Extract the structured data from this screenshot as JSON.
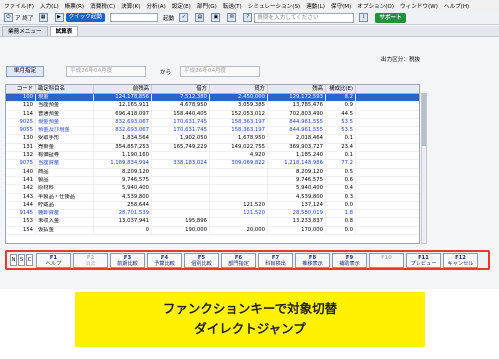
{
  "menu": [
    "ファイル(F)",
    "入力(L)",
    "帳票(R)",
    "消費税(C)",
    "決算(K)",
    "分析(A)",
    "設定(E)",
    "部門(G)",
    "転送(T)",
    "シミュレーション(S)",
    "連動(L)",
    "保守(M)",
    "オプション(O)",
    "ウィンドウ(W)",
    "ヘルプ(H)"
  ],
  "toolbar": {
    "exit": "ア 終了",
    "quick": "クイック起動",
    "start": "起動",
    "search_placeholder": "質問を入力してください",
    "support": "サポート"
  },
  "tabs": [
    "業務メニュー",
    "試算表"
  ],
  "output_kubun": "出力区分：税抜",
  "period": {
    "button": "単月指定",
    "from": "平成26年04月度",
    "to_label": "から",
    "to": "平成26年04月度"
  },
  "grid": {
    "headers": [
      "コード",
      "勘定科目名",
      "前残高",
      "借方",
      "貸方",
      "残高",
      "構成比(E)"
    ],
    "rows": [
      {
        "code": "100",
        "name": "現金",
        "prev": "124,178,856",
        "debit": "7,512,380",
        "credit": "2,450,000",
        "bal": "129,172,593",
        "ratio": "8.2",
        "type": "sel"
      },
      {
        "code": "110",
        "name": "当座預金",
        "prev": "12,165,911",
        "debit": "4,678,950",
        "credit": "3,059,385",
        "bal": "13,785,476",
        "ratio": "0.9",
        "type": ""
      },
      {
        "code": "114",
        "name": "普通預金",
        "prev": "696,418,097",
        "debit": "158,440,405",
        "credit": "152,053,012",
        "bal": "702,803,490",
        "ratio": "44.5",
        "type": ""
      },
      {
        "code": "9025",
        "name": "現金預金",
        "prev": "832,693,067",
        "debit": "170,631,745",
        "credit": "158,363,197",
        "bal": "844,961,555",
        "ratio": "53.5",
        "type": "tot"
      },
      {
        "code": "9055",
        "name": "預金及び現金",
        "prev": "832,693,067",
        "debit": "170,631,745",
        "credit": "158,363,197",
        "bal": "844,961,555",
        "ratio": "53.5",
        "type": "tot"
      },
      {
        "code": "130",
        "name": "受取手形",
        "prev": "1,834,564",
        "debit": "1,902,050",
        "credit": "1,678,950",
        "bal": "2,018,464",
        "ratio": "0.1",
        "type": ""
      },
      {
        "code": "131",
        "name": "売掛金",
        "prev": "354,857,253",
        "debit": "165,749,229",
        "credit": "149,022,755",
        "bal": "369,903,727",
        "ratio": "23.4",
        "type": ""
      },
      {
        "code": "132",
        "name": "有価証券",
        "prev": "1,190,160",
        "debit": "",
        "credit": "4,920",
        "bal": "1,185,240",
        "ratio": "0.1",
        "type": ""
      },
      {
        "code": "9075",
        "name": "当座資産",
        "prev": "1,189,834,994",
        "debit": "338,183,024",
        "credit": "309,069,822",
        "bal": "1,218,148,986",
        "ratio": "77.2",
        "type": "tot"
      },
      {
        "code": "140",
        "name": "商品",
        "prev": "8,209,120",
        "debit": "",
        "credit": "",
        "bal": "8,209,120",
        "ratio": "0.5",
        "type": ""
      },
      {
        "code": "141",
        "name": "製品",
        "prev": "9,746,575",
        "debit": "",
        "credit": "",
        "bal": "9,746,575",
        "ratio": "0.6",
        "type": ""
      },
      {
        "code": "142",
        "name": "原材料",
        "prev": "5,940,400",
        "debit": "",
        "credit": "",
        "bal": "5,940,400",
        "ratio": "0.4",
        "type": ""
      },
      {
        "code": "143",
        "name": "半製品・仕掛品",
        "prev": "4,539,800",
        "debit": "",
        "credit": "",
        "bal": "4,539,800",
        "ratio": "0.3",
        "type": ""
      },
      {
        "code": "144",
        "name": "貯蔵品",
        "prev": "258,644",
        "debit": "",
        "credit": "121,520",
        "bal": "137,124",
        "ratio": "0.0",
        "type": ""
      },
      {
        "code": "9145",
        "name": "棚卸資産",
        "prev": "28,701,539",
        "debit": "",
        "credit": "121,520",
        "bal": "28,580,019",
        "ratio": "1.8",
        "type": "tot"
      },
      {
        "code": "153",
        "name": "未収入金",
        "prev": "13,037,941",
        "debit": "195,896",
        "credit": "",
        "bal": "13,233,837",
        "ratio": "0.8",
        "type": ""
      },
      {
        "code": "154",
        "name": "仮払金",
        "prev": "0",
        "debit": "190,000",
        "credit": "20,000",
        "bal": "170,000",
        "ratio": "0.0",
        "type": ""
      }
    ]
  },
  "fkeys": [
    {
      "num": "F1",
      "label": "ヘルプ",
      "enabled": true
    },
    {
      "num": "F2",
      "label": "消去",
      "enabled": false
    },
    {
      "num": "F3",
      "label": "前期比較",
      "enabled": true
    },
    {
      "num": "F4",
      "label": "予算比較",
      "enabled": true
    },
    {
      "num": "F5",
      "label": "個別比較",
      "enabled": true
    },
    {
      "num": "F6",
      "label": "部門指定",
      "enabled": true
    },
    {
      "num": "F7",
      "label": "科目検出",
      "enabled": true
    },
    {
      "num": "F8",
      "label": "推移表示",
      "enabled": true
    },
    {
      "num": "F9",
      "label": "補助表示",
      "enabled": true
    },
    {
      "num": "F10",
      "label": "",
      "enabled": false
    },
    {
      "num": "F11",
      "label": "プレビュー",
      "enabled": true
    },
    {
      "num": "F12",
      "label": "キャンセル",
      "enabled": true
    }
  ],
  "modifiers": [
    "N",
    "S",
    "C"
  ],
  "banner": {
    "line1": "ファンクションキーで対象切替",
    "line2": "ダイレクトジャンプ"
  },
  "colors": {
    "accent": "#1e64c8",
    "highlight": "#e53a2f",
    "banner": "#fff100",
    "selected_row": "#2f63c8"
  },
  "scroll": {
    "thumb_fraction": 0.35
  }
}
